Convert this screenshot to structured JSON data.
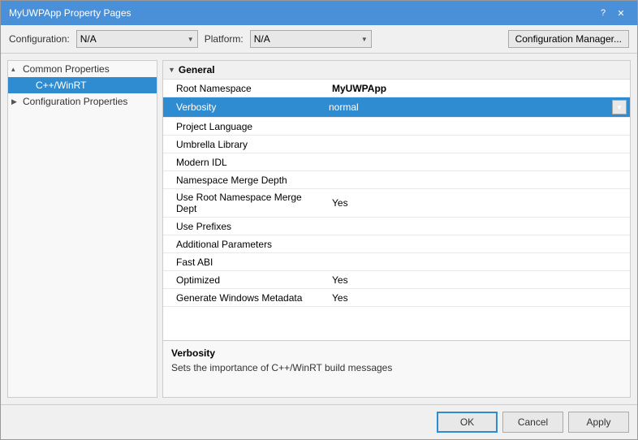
{
  "dialog": {
    "title": "MyUWPApp Property Pages",
    "title_bar_question": "?",
    "title_bar_close": "✕"
  },
  "config_bar": {
    "configuration_label": "Configuration:",
    "configuration_value": "N/A",
    "platform_label": "Platform:",
    "platform_value": "N/A",
    "manager_button": "Configuration Manager..."
  },
  "tree": {
    "items": [
      {
        "id": "common-properties",
        "label": "Common Properties",
        "level": 0,
        "toggle": "▴",
        "selected": false
      },
      {
        "id": "cppwinrt",
        "label": "C++/WinRT",
        "level": 1,
        "toggle": "",
        "selected": true
      },
      {
        "id": "config-properties",
        "label": "Configuration Properties",
        "level": 0,
        "toggle": "▶",
        "selected": false
      }
    ]
  },
  "properties": {
    "section_label": "General",
    "section_toggle": "▼",
    "rows": [
      {
        "id": "root-namespace",
        "name": "Root Namespace",
        "value": "MyUWPApp",
        "bold": true,
        "highlighted": false,
        "has_dropdown": false
      },
      {
        "id": "verbosity",
        "name": "Verbosity",
        "value": "normal",
        "bold": false,
        "highlighted": true,
        "has_dropdown": true
      },
      {
        "id": "project-language",
        "name": "Project Language",
        "value": "",
        "bold": false,
        "highlighted": false,
        "has_dropdown": false
      },
      {
        "id": "umbrella-library",
        "name": "Umbrella Library",
        "value": "",
        "bold": false,
        "highlighted": false,
        "has_dropdown": false
      },
      {
        "id": "modern-idl",
        "name": "Modern IDL",
        "value": "",
        "bold": false,
        "highlighted": false,
        "has_dropdown": false
      },
      {
        "id": "namespace-merge-depth",
        "name": "Namespace Merge Depth",
        "value": "",
        "bold": false,
        "highlighted": false,
        "has_dropdown": false
      },
      {
        "id": "use-root-namespace-merge",
        "name": "Use Root Namespace Merge Dept",
        "value": "Yes",
        "bold": false,
        "highlighted": false,
        "has_dropdown": false
      },
      {
        "id": "use-prefixes",
        "name": "Use Prefixes",
        "value": "",
        "bold": false,
        "highlighted": false,
        "has_dropdown": false
      },
      {
        "id": "additional-parameters",
        "name": "Additional Parameters",
        "value": "",
        "bold": false,
        "highlighted": false,
        "has_dropdown": false
      },
      {
        "id": "fast-abi",
        "name": "Fast ABI",
        "value": "",
        "bold": false,
        "highlighted": false,
        "has_dropdown": false
      },
      {
        "id": "optimized",
        "name": "Optimized",
        "value": "Yes",
        "bold": false,
        "highlighted": false,
        "has_dropdown": false
      },
      {
        "id": "generate-windows-metadata",
        "name": "Generate Windows Metadata",
        "value": "Yes",
        "bold": false,
        "highlighted": false,
        "has_dropdown": false
      }
    ]
  },
  "description": {
    "title": "Verbosity",
    "text": "Sets the importance of C++/WinRT build messages"
  },
  "footer": {
    "ok_label": "OK",
    "cancel_label": "Cancel",
    "apply_label": "Apply"
  },
  "colors": {
    "title_bar": "#4a90d9",
    "selection": "#308cd0",
    "border": "#aaa"
  }
}
